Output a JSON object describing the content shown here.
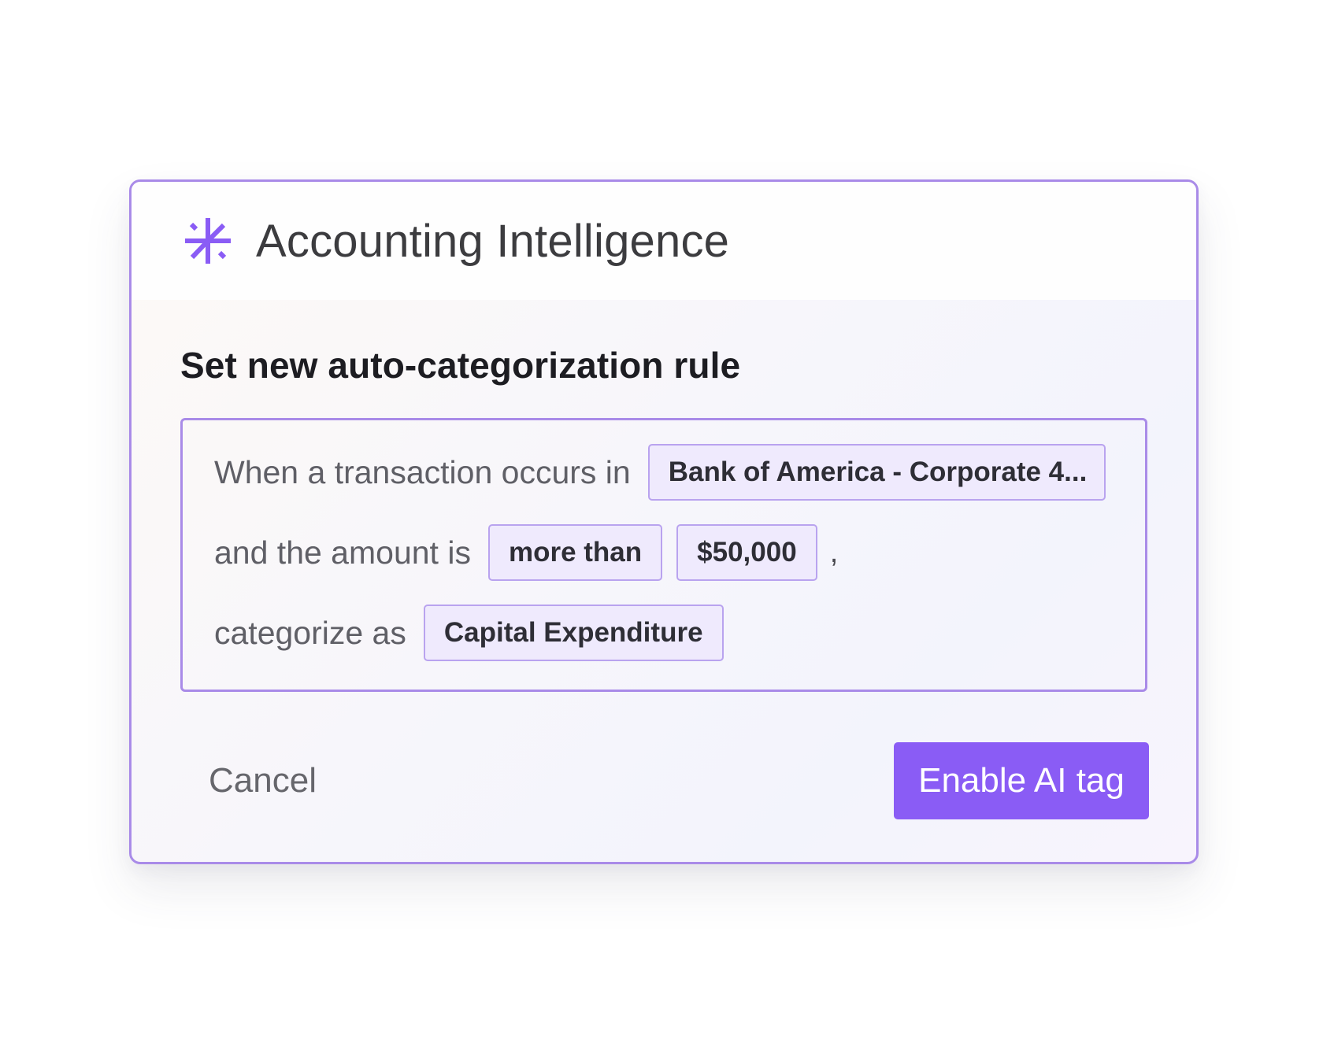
{
  "header": {
    "title": "Accounting Intelligence",
    "icon": "sparkle-icon",
    "accent_color": "#8a5cf5"
  },
  "rule": {
    "heading": "Set new auto-categorization rule",
    "row1_text": "When a transaction occurs in",
    "account_value": "Bank of America - Corporate 4...",
    "row2_text": "and the amount is",
    "comparator_value": "more than",
    "amount_value": "$50,000",
    "separator": ",",
    "row3_text": "categorize as",
    "category_value": "Capital Expenditure"
  },
  "actions": {
    "cancel_label": "Cancel",
    "confirm_label": "Enable AI tag"
  },
  "colors": {
    "border": "#a98be8",
    "chip_background": "#efeafd",
    "chip_border": "#b9a3ef",
    "primary_button": "#8a5cf5"
  }
}
